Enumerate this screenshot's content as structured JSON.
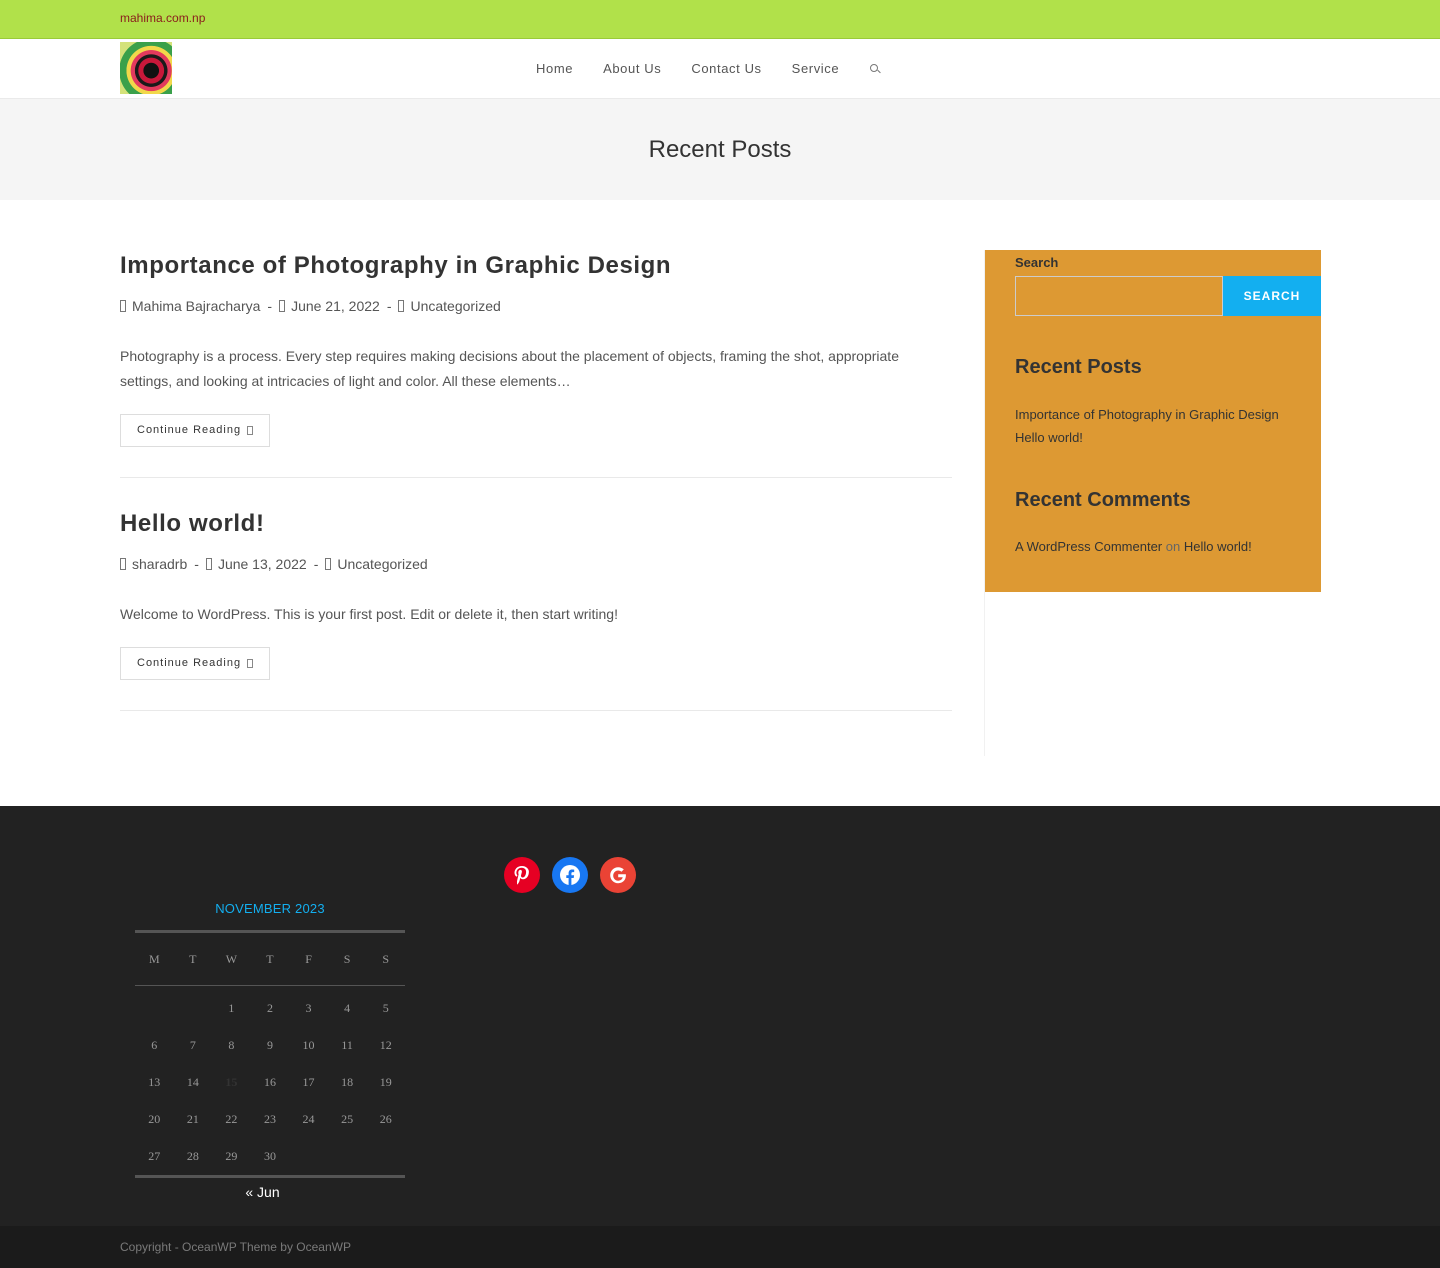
{
  "topbar": {
    "site_link": "mahima.com.np"
  },
  "nav": {
    "items": [
      "Home",
      "About Us",
      "Contact Us",
      "Service"
    ],
    "search_icon": "search-icon"
  },
  "page_title": "Recent Posts",
  "posts": [
    {
      "title": "Importance of Photography in Graphic Design",
      "author": "Mahima Bajracharya",
      "date": "June 21, 2022",
      "category": "Uncategorized",
      "excerpt": "Photography is a process. Every step requires making decisions about the placement of objects, framing the shot, appropriate settings, and looking at intricacies of light and color. All these elements…",
      "button": "Continue Reading"
    },
    {
      "title": "Hello world!",
      "author": "sharadrb",
      "date": "June 13, 2022",
      "category": "Uncategorized",
      "excerpt": "Welcome to WordPress. This is your first post. Edit or delete it, then start writing!",
      "button": "Continue Reading"
    }
  ],
  "sidebar": {
    "search_label": "Search",
    "search_placeholder": "",
    "search_button": "SEARCH",
    "recent_posts_title": "Recent Posts",
    "recent_posts": [
      "Importance of Photography in Graphic Design",
      "Hello world!"
    ],
    "recent_comments_title": "Recent Comments",
    "comment_author": "A WordPress Commenter",
    "comment_on": "on",
    "comment_post": "Hello world!",
    "bg_color": "#dd9933",
    "accent_color": "#13aff0"
  },
  "footer": {
    "calendar": {
      "caption": "NOVEMBER 2023",
      "weekdays": [
        "M",
        "T",
        "W",
        "T",
        "F",
        "S",
        "S"
      ],
      "weeks": [
        [
          "",
          "",
          "1",
          "2",
          "3",
          "4",
          "5"
        ],
        [
          "6",
          "7",
          "8",
          "9",
          "10",
          "11",
          "12"
        ],
        [
          "13",
          "14",
          "15",
          "16",
          "17",
          "18",
          "19"
        ],
        [
          "20",
          "21",
          "22",
          "23",
          "24",
          "25",
          "26"
        ],
        [
          "27",
          "28",
          "29",
          "30",
          "",
          "",
          ""
        ]
      ],
      "today": "15",
      "prev_link": "« Jun"
    },
    "social": [
      "pinterest-icon",
      "facebook-icon",
      "google-icon"
    ]
  },
  "copyright": "Copyright - OceanWP Theme by OceanWP"
}
